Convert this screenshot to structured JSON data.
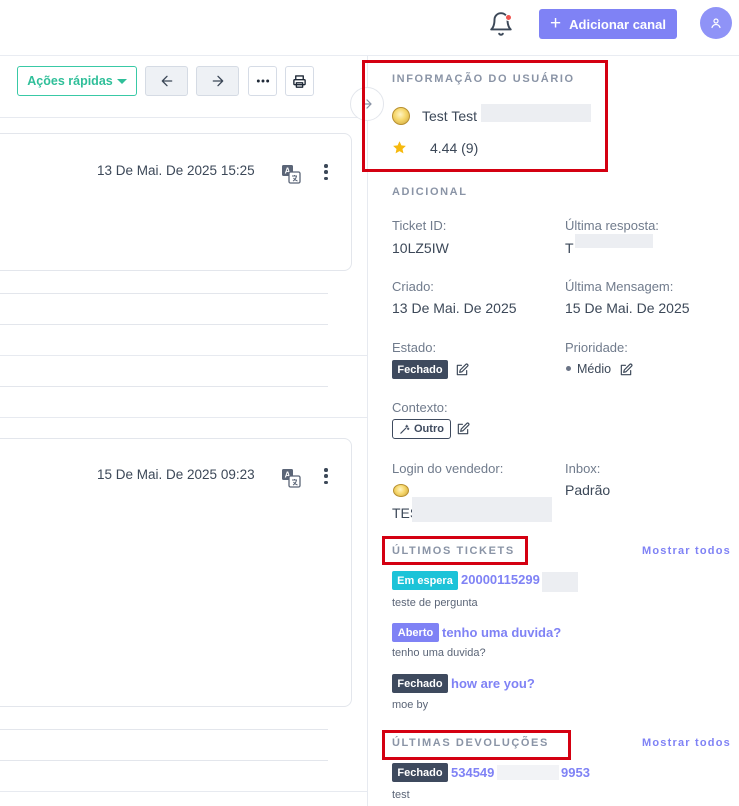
{
  "header": {
    "add_channel_label": "Adicionar canal",
    "icons": {
      "bell": "bell-icon",
      "plus": "plus-icon",
      "avatar": "user-icon"
    },
    "colors": {
      "accent": "#7f82f5",
      "notification_dot": "#f0544f"
    }
  },
  "toolbar": {
    "quick_actions_label": "Ações rápidas",
    "icons": [
      "arrow-left-icon",
      "arrow-right-icon",
      "more-horizontal-icon",
      "print-icon"
    ]
  },
  "messages": [
    {
      "date": "13 De Mai. De 2025 15:25"
    },
    {
      "date": "15 De Mai. De 2025 09:23"
    }
  ],
  "user_info": {
    "title": "INFORMAÇÃO DO USUÁRIO",
    "name": "Test Test",
    "rating": "4.44 (9)"
  },
  "additional": {
    "title": "ADICIONAL",
    "ticket_id_label": "Ticket ID:",
    "ticket_id": "10LZ5IW",
    "last_reply_label": "Última resposta:",
    "last_reply_value": "T",
    "created_label": "Criado:",
    "created_value": "13 De Mai. De 2025",
    "last_message_label": "Última Mensagem:",
    "last_message_value": "15 De Mai. De 2025",
    "status_label": "Estado:",
    "status_value": "Fechado",
    "priority_label": "Prioridade:",
    "priority_value": "Médio",
    "context_label": "Contexto:",
    "context_value": "Outro",
    "seller_login_label": "Login do vendedor:",
    "seller_login_value": "TES",
    "inbox_label": "Inbox:",
    "inbox_value": "Padrão"
  },
  "last_tickets": {
    "title": "ÚLTIMOS TICKETS",
    "show_all": "Mostrar todos",
    "items": [
      {
        "status": "Em espera",
        "title": "20000115299",
        "subtitle": "teste de pergunta"
      },
      {
        "status": "Aberto",
        "title": "tenho uma duvida?",
        "subtitle": "tenho uma duvida?"
      },
      {
        "status": "Fechado",
        "title": "how are you?",
        "subtitle": "moe by"
      }
    ]
  },
  "last_returns": {
    "title": "ÚLTIMAS DEVOLUÇÕES",
    "show_all": "Mostrar todos",
    "items": [
      {
        "status": "Fechado",
        "id_start": "534549",
        "id_end": "9953",
        "subtitle": "test"
      }
    ]
  }
}
